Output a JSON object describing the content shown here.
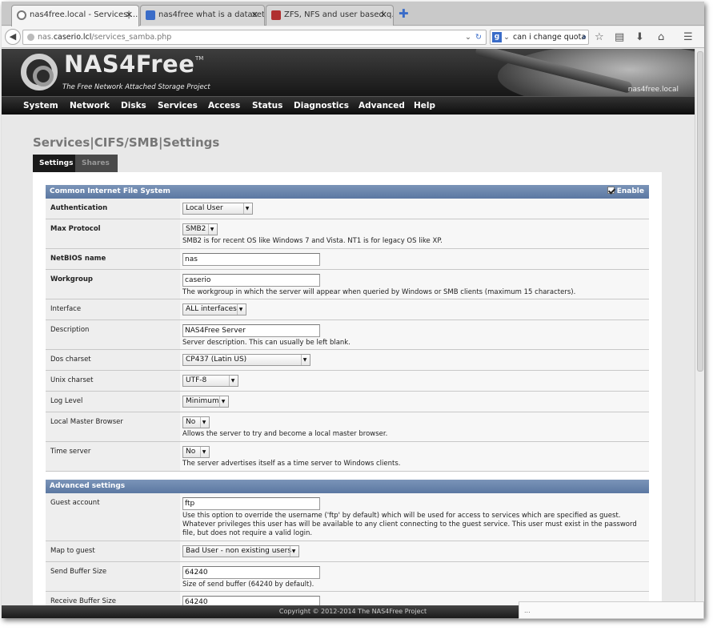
{
  "browser": {
    "tabs": [
      {
        "title": "nas4free.local - Services|..."
      },
      {
        "title": "nas4free what is a dataset ..."
      },
      {
        "title": "ZFS, NFS and user based q..."
      }
    ],
    "url_prefix": "nas.",
    "url_host": "caserio.lcl",
    "url_path": "/services_samba.php",
    "search_text": "can i change quota",
    "search_engine_letter": "g"
  },
  "header": {
    "logo": "NAS4Free",
    "tm": "TM",
    "tagline": "The Free Network Attached Storage Project",
    "hostname": "nas4free.local"
  },
  "menu": [
    "System",
    "Network",
    "Disks",
    "Services",
    "Access",
    "Status",
    "Diagnostics",
    "Advanced",
    "Help"
  ],
  "page_title": "Services|CIFS/SMB|Settings",
  "tabs": {
    "settings": "Settings",
    "shares": "Shares"
  },
  "section1": {
    "title": "Common Internet File System",
    "enable_label": "Enable"
  },
  "rows": {
    "authentication": {
      "label": "Authentication",
      "value": "Local User"
    },
    "max_protocol": {
      "label": "Max Protocol",
      "value": "SMB2",
      "hint": "SMB2 is for recent OS like Windows 7 and Vista. NT1 is for legacy OS like XP."
    },
    "netbios": {
      "label": "NetBIOS name",
      "value": "nas"
    },
    "workgroup": {
      "label": "Workgroup",
      "value": "caserio",
      "hint": "The workgroup in which the server will appear when queried by Windows or SMB clients (maximum 15 characters)."
    },
    "interface": {
      "label": "Interface",
      "value": "ALL interfaces"
    },
    "description": {
      "label": "Description",
      "value": "NAS4Free Server",
      "hint": "Server description. This can usually be left blank."
    },
    "dos_charset": {
      "label": "Dos charset",
      "value": "CP437 (Latin US)"
    },
    "unix_charset": {
      "label": "Unix charset",
      "value": "UTF-8"
    },
    "log_level": {
      "label": "Log Level",
      "value": "Minimum"
    },
    "local_master": {
      "label": "Local Master Browser",
      "value": "No",
      "hint": "Allows the server to try and become a local master browser."
    },
    "time_server": {
      "label": "Time server",
      "value": "No",
      "hint": "The server advertises itself as a time server to Windows clients."
    }
  },
  "section2": {
    "title": "Advanced settings"
  },
  "adv": {
    "guest_account": {
      "label": "Guest account",
      "value": "ftp",
      "hint1": "Use this option to override the username ('ftp' by default) which will be used for access to services which are specified as guest.",
      "hint2": "Whatever privileges this user has will be available to any client connecting to the guest service. This user must exist in the password",
      "hint3": "file, but does not require a valid login."
    },
    "map_to_guest": {
      "label": "Map to guest",
      "value": "Bad User - non existing users"
    },
    "send_buffer": {
      "label": "Send Buffer Size",
      "value": "64240",
      "hint": "Size of send buffer (64240 by default)."
    },
    "recv_buffer": {
      "label": "Receive Buffer Size",
      "value": "64240"
    }
  },
  "footer": "Copyright © 2012-2014 The NAS4Free Project",
  "popup": "..."
}
